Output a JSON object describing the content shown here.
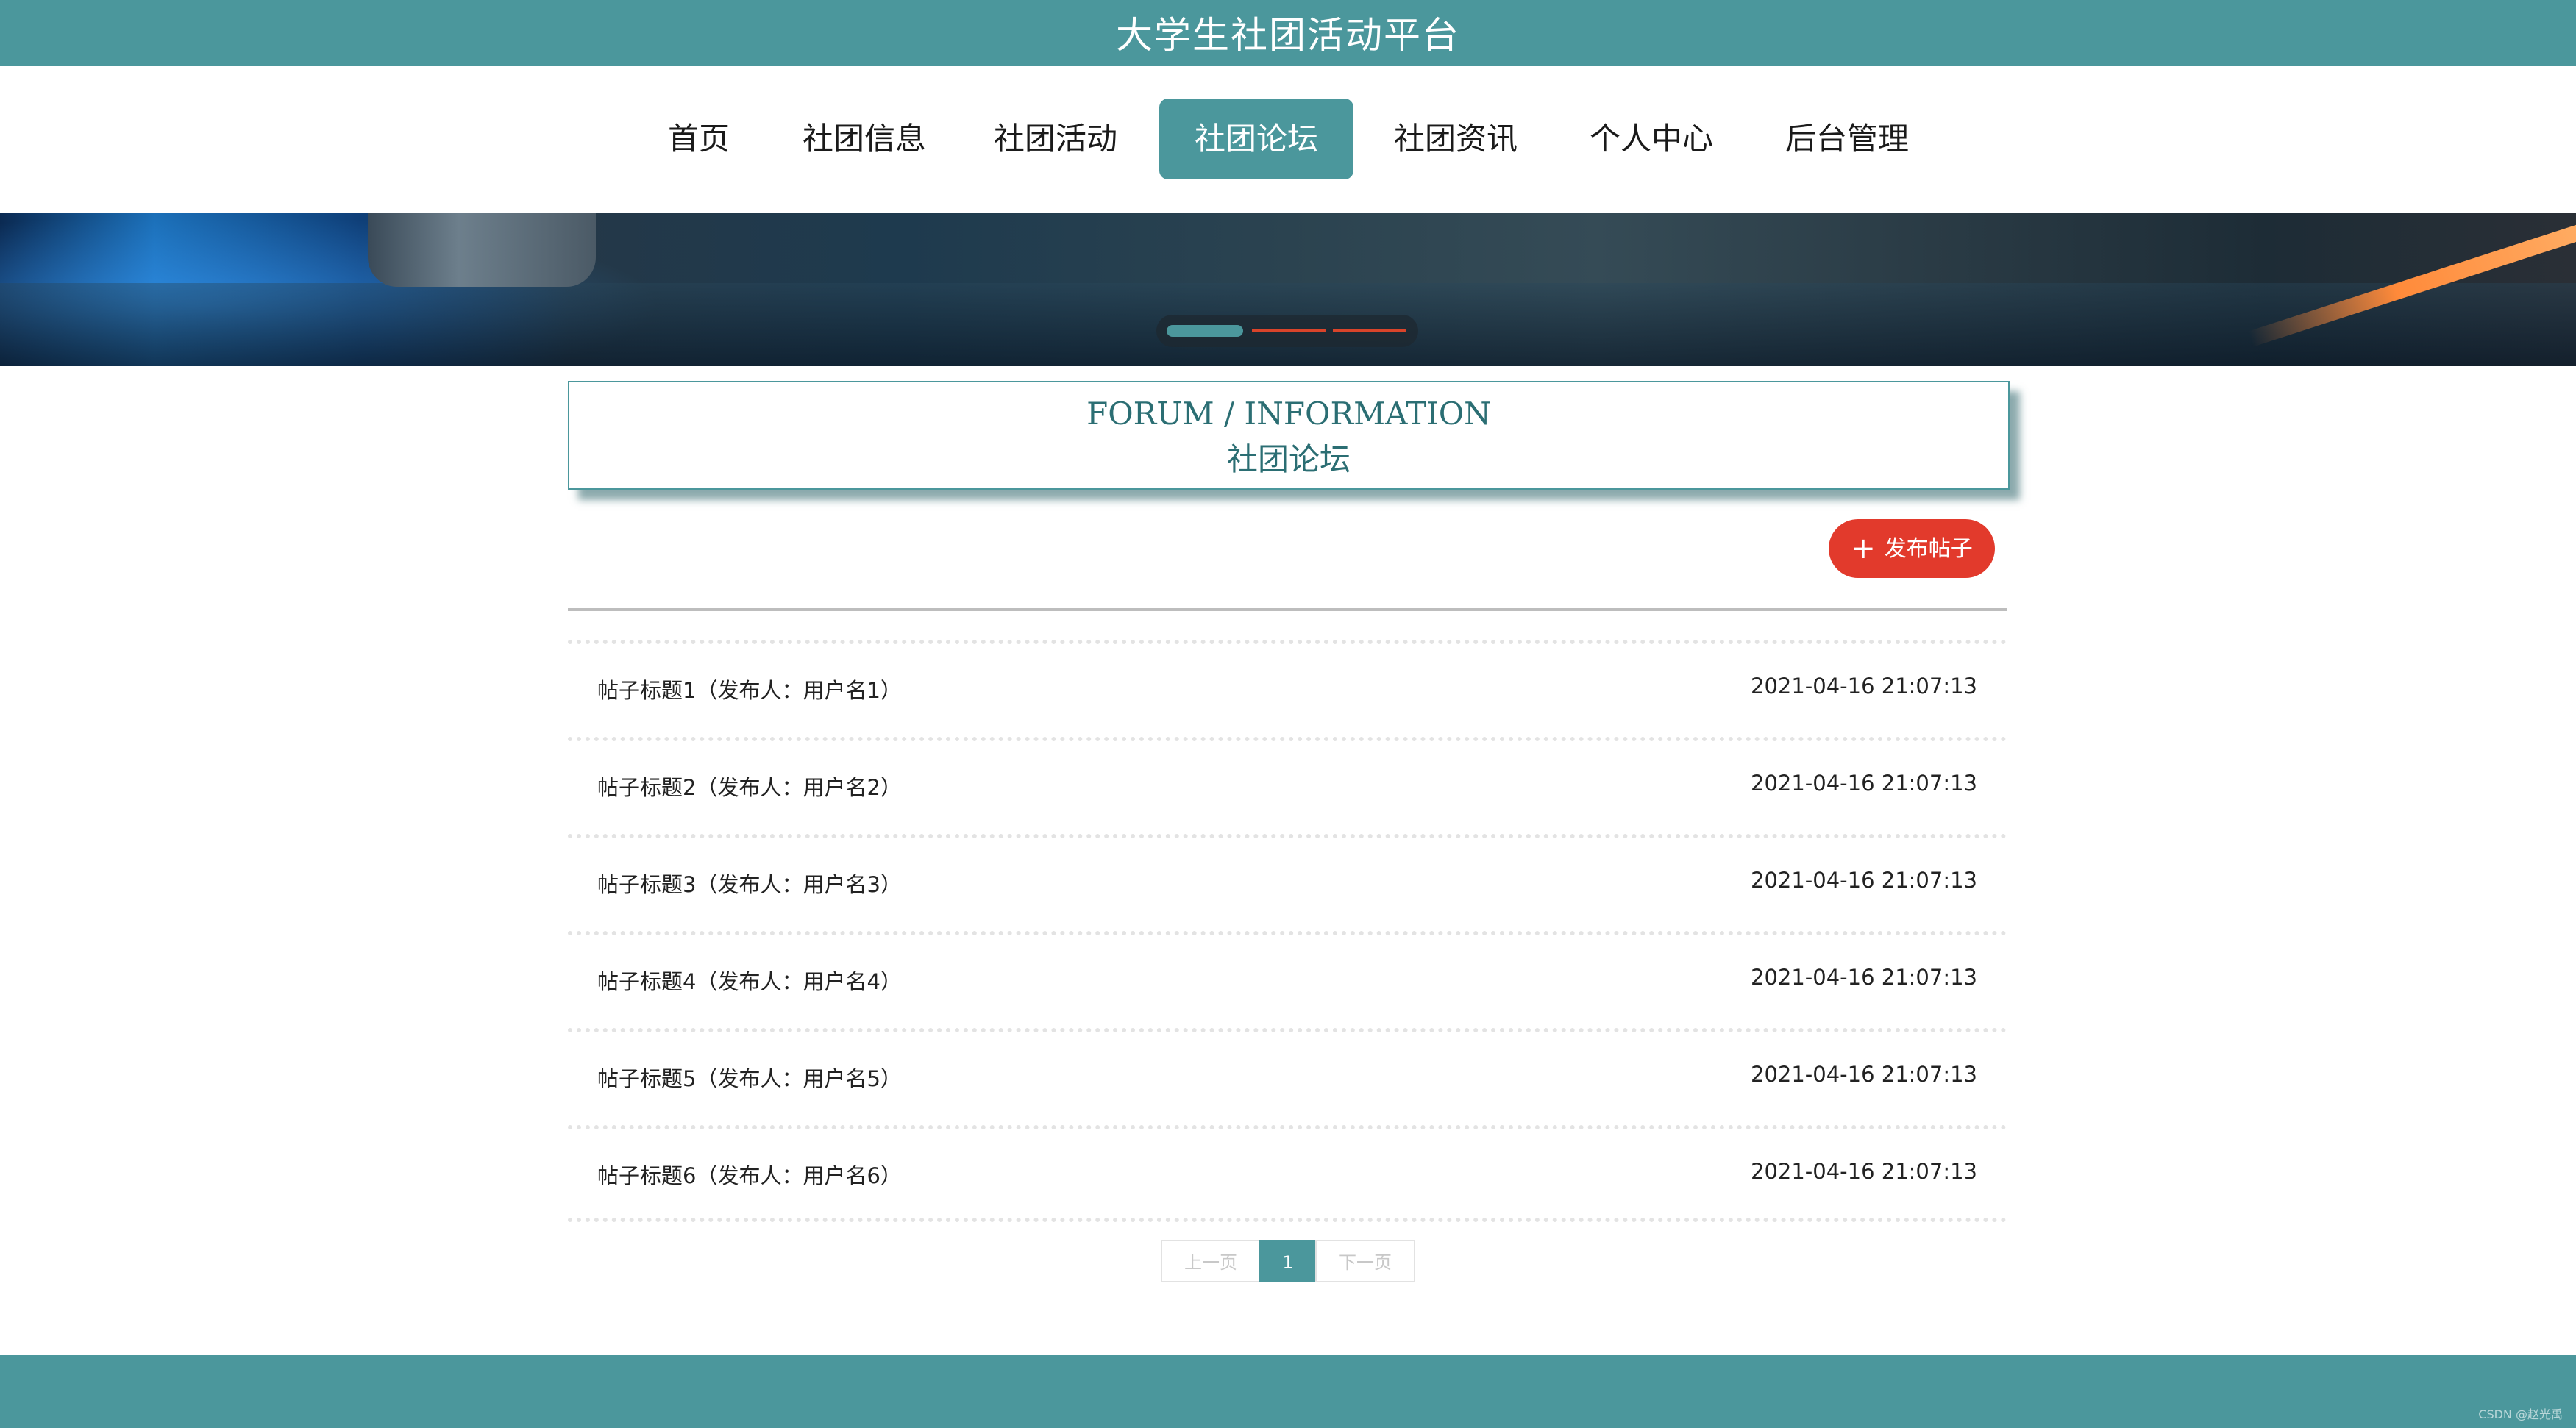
{
  "header": {
    "title": "大学生社团活动平台"
  },
  "nav": {
    "items": [
      {
        "label": "首页"
      },
      {
        "label": "社团信息"
      },
      {
        "label": "社团活动"
      },
      {
        "label": "社团论坛",
        "active": true
      },
      {
        "label": "社团资讯"
      },
      {
        "label": "个人中心"
      },
      {
        "label": "后台管理"
      }
    ]
  },
  "banner": {
    "slides": 3,
    "active_slide": 1
  },
  "section": {
    "title_en": "FORUM / INFORMATION",
    "title_cn": "社团论坛"
  },
  "actions": {
    "publish_label": "发布帖子"
  },
  "posts": [
    {
      "title": "帖子标题1（发布人：用户名1）",
      "date": "2021-04-16 21:07:13"
    },
    {
      "title": "帖子标题2（发布人：用户名2）",
      "date": "2021-04-16 21:07:13"
    },
    {
      "title": "帖子标题3（发布人：用户名3）",
      "date": "2021-04-16 21:07:13"
    },
    {
      "title": "帖子标题4（发布人：用户名4）",
      "date": "2021-04-16 21:07:13"
    },
    {
      "title": "帖子标题5（发布人：用户名5）",
      "date": "2021-04-16 21:07:13"
    },
    {
      "title": "帖子标题6（发布人：用户名6）",
      "date": "2021-04-16 21:07:13"
    }
  ],
  "pagination": {
    "prev": "上一页",
    "current": "1",
    "next": "下一页"
  },
  "footer": {
    "watermark": "CSDN @赵光禹"
  },
  "colors": {
    "primary": "#4b979c",
    "accent": "#e23a2c"
  }
}
